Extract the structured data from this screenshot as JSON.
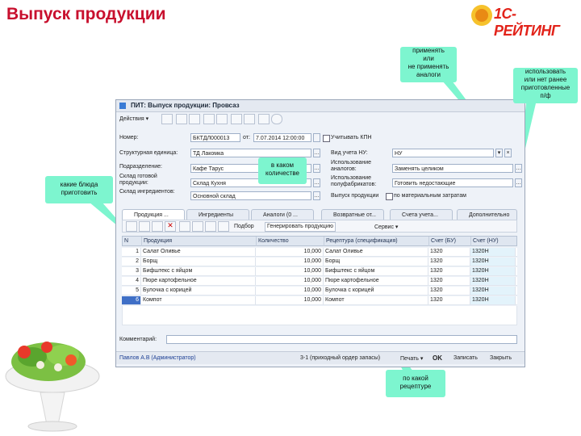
{
  "slide": {
    "title": "Выпуск продукции",
    "logo_text": "1С-РЕЙТИНГ"
  },
  "callouts": {
    "analogs": "применять\nили\nне применять\nаналоги",
    "prepared": "использовать\nили нет ранее\nприготовленные\nп/ф",
    "quantity": "в каком\nколичестве",
    "dishes": "какие блюда\nприготовить",
    "recipe": "по какой\nрецептуре"
  },
  "window": {
    "title": "ПИТ: Выпуск продукции: Провсаз",
    "toolbar": {
      "actions_label": "Действия ▾"
    },
    "fields": {
      "number_label": "Номер:",
      "number_value": "БКТДЛ000013",
      "date_label": "от:",
      "date_value": "7.07.2014 12:00:00",
      "kpn_label": "Учитывать КПН",
      "unit_label": "Структурная единица:",
      "unit_value": "ТД Лакомка",
      "division_label": "Подразделение:",
      "division_value": "Кафе Тарус",
      "warehouse_label": "Склад готовой продукции:",
      "warehouse_value": "Склад Кухня",
      "ingredients_label": "Склад ингредиентов:",
      "ingredients_value": "Основной склад",
      "tax_label": "Вид учета НУ:",
      "tax_value": "НУ",
      "analogs_label": "Использование аналогов:",
      "analogs_value": "Заменять целиком",
      "semi_label": "Использование полуфабрикатов:",
      "semi_value": "Готовить недостающие",
      "release_label": "Выпуск продукции",
      "release_value": "по материальным затратам"
    },
    "tabs": [
      "Продукция ...",
      "Ингредиенты",
      "Аналоги (0 ...",
      "Возвратные от...",
      "Счета учета...",
      "Дополнительно"
    ],
    "grid_toolbar": {
      "pick": "Подбор",
      "generate": "Генерировать продукцию",
      "service": "Сервис ▾"
    },
    "grid": {
      "columns": [
        "N",
        "Продукция",
        "Количество",
        "Рецептура (спецификация)",
        "Счет (БУ)",
        "Счет (НУ)"
      ],
      "rows": [
        [
          "1",
          "Салат Оливье",
          "10,000",
          "Салат Оливье",
          "1320",
          "1320Н"
        ],
        [
          "2",
          "Борщ",
          "10,000",
          "Борщ",
          "1320",
          "1320Н"
        ],
        [
          "3",
          "Бифштекс с яйцом",
          "10,000",
          "Бифштекс с яйцом",
          "1320",
          "1320Н"
        ],
        [
          "4",
          "Пюре картофельное",
          "10,000",
          "Пюре картофельное",
          "1320",
          "1320Н"
        ],
        [
          "5",
          "Булочка с корицей",
          "10,000",
          "Булочка с корицей",
          "1320",
          "1320Н"
        ],
        [
          "6",
          "Компот",
          "10,000",
          "Компот",
          "1320",
          "1320Н"
        ]
      ]
    },
    "comment_label": "Комментарий:",
    "status": {
      "user": "Павлов А.В (Администратор)",
      "form": "3-1 (приходный ордер запасы)",
      "print": "Печать ▾",
      "ok": "OK",
      "save": "Записать",
      "close": "Закрыть"
    }
  },
  "colors": {
    "title": "#c8102e",
    "callout": "#7df5cf",
    "logo": "#e2231a"
  }
}
